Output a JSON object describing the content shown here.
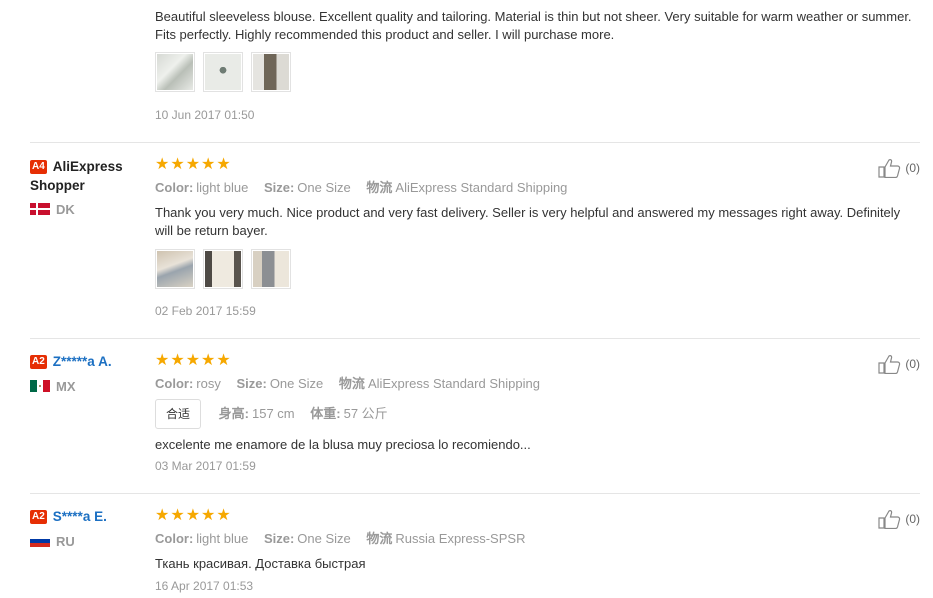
{
  "labels": {
    "color": "Color:",
    "size": "Size:",
    "shipping": "物流",
    "fit_button": "合适",
    "height": "身高:",
    "weight": "体重:"
  },
  "reviews": [
    {
      "text": "Beautiful sleeveless blouse. Excellent quality and tailoring. Material is thin but not sheer. Very suitable for warm weather or summer. Fits perfectly. Highly recommended this product and seller. I will purchase more.",
      "date": "10 Jun 2017 01:50"
    },
    {
      "badge": "A4",
      "name": "AliExpress Shopper",
      "country": "DK",
      "color": "light blue",
      "size": "One Size",
      "shipping": "AliExpress Standard Shipping",
      "text": "Thank you very much. Nice product and very fast delivery. Seller is very helpful and answered my messages right away. Definitely will be return bayer.",
      "date": "02 Feb 2017 15:59",
      "likes": "(0)"
    },
    {
      "badge": "A2",
      "name": "Z*****a A.",
      "country": "MX",
      "color": "rosy",
      "size": "One Size",
      "shipping": "AliExpress Standard Shipping",
      "height": "157 cm",
      "weight": "57 公斤",
      "text": "excelente me enamore de la blusa muy preciosa lo recomiendo...",
      "date": "03 Mar 2017 01:59",
      "likes": "(0)"
    },
    {
      "badge": "A2",
      "name": "S****a E.",
      "country": "RU",
      "color": "light blue",
      "size": "One Size",
      "shipping": "Russia Express-SPSR",
      "text": "Ткань красивая. Доставка быстрая",
      "date": "16 Apr 2017 01:53",
      "likes": "(0)"
    }
  ],
  "rating_stars": "★★★★★",
  "colors": {
    "star": "#f6a800",
    "badge": "#e62e04",
    "link": "#1b6fc2"
  }
}
